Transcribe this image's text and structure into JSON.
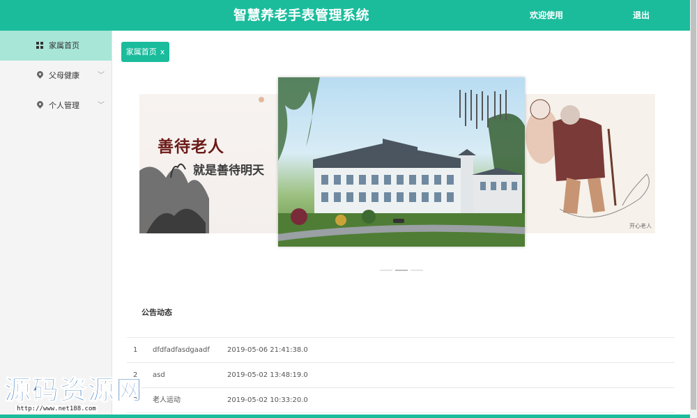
{
  "header": {
    "title": "智慧养老手表管理系统",
    "welcome": "欢迎使用",
    "logout": "退出"
  },
  "sidebar": {
    "items": [
      {
        "label": "家属首页",
        "icon": "grid-icon",
        "active": true
      },
      {
        "label": "父母健康",
        "icon": "location-pin-icon",
        "chevron": "﹀"
      },
      {
        "label": "个人管理",
        "icon": "location-pin-icon",
        "chevron": "﹀"
      }
    ]
  },
  "tab": {
    "label": "家属首页",
    "close": "x"
  },
  "carousel": {
    "left_slide": {
      "line1": "善待老人",
      "line2": "就是善待明天"
    },
    "right_slide": {
      "caption": "开心老人"
    },
    "active_index": 1
  },
  "notices": {
    "title": "公告动态",
    "rows": [
      {
        "no": "1",
        "title": "dfdfadfasdgaadf",
        "time": "2019-05-06 21:41:38.0"
      },
      {
        "no": "2",
        "title": "asd",
        "time": "2019-05-02 13:48:19.0"
      },
      {
        "no": "3",
        "title": "老人运动",
        "time": "2019-05-02 10:33:20.0"
      }
    ]
  },
  "watermark": {
    "text": "源码资源网",
    "url": "http://www.net188.com"
  },
  "colors": {
    "accent": "#1abc9c",
    "sidebar_active": "#a8e6d8"
  }
}
